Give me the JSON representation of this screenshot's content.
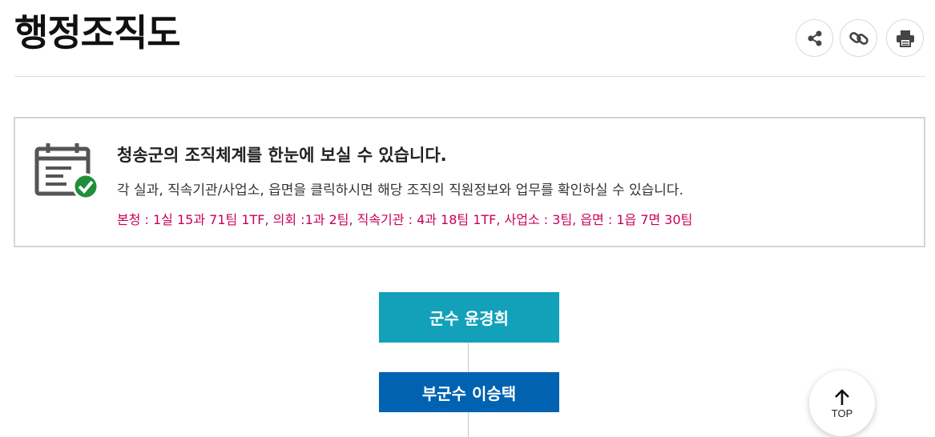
{
  "page": {
    "title": "행정조직도"
  },
  "toolbar": {
    "share_icon": "share-icon",
    "link_icon": "link-icon",
    "print_icon": "print-icon"
  },
  "info": {
    "icon": "calendar-check-icon",
    "heading": "청송군의 조직체계를 한눈에 보실 수 있습니다.",
    "description": "각 실과, 직속기관/사업소, 읍면을 클릭하시면 해당 조직의 직원정보와 업무를 확인하실 수 있습니다.",
    "stats": "본청 : 1실 15과 71팀 1TF, 의회 :1과 2팀, 직속기관 : 4과 18팀 1TF, 사업소 : 3팀, 읍면 : 1읍 7면 30팀"
  },
  "org_chart": {
    "mayor": "군수 윤경희",
    "vice_mayor": "부군수 이승택"
  },
  "top_button": {
    "label": "TOP"
  },
  "colors": {
    "mayor_box": "#12a1b9",
    "vice_mayor_box": "#0062b0",
    "stats_text": "#c8005a",
    "check_badge": "#1f8f3a"
  }
}
